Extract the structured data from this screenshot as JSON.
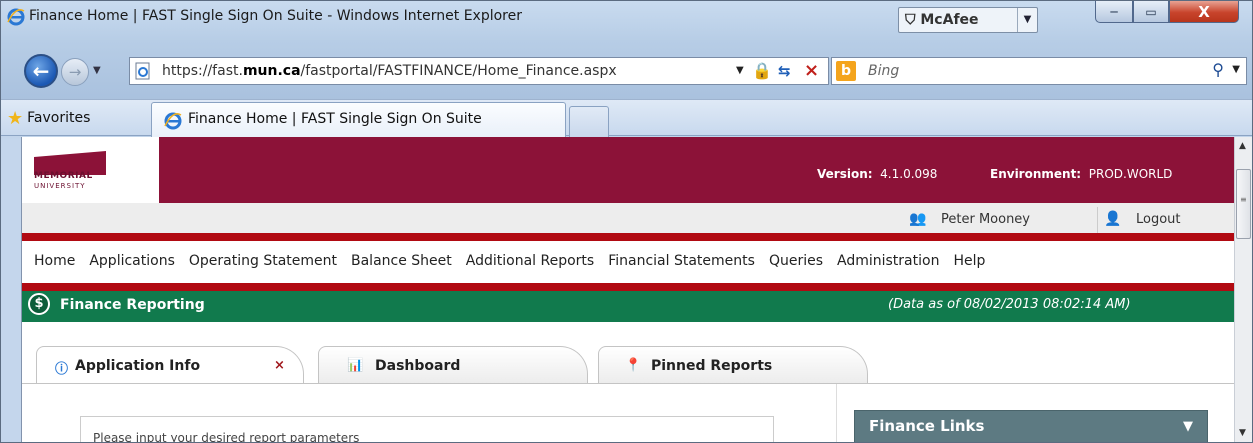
{
  "window": {
    "title": "Finance Home | FAST Single Sign On Suite - Windows Internet Explorer",
    "mcafee_label": "McAfee",
    "controls": {
      "minimize": "─",
      "maximize": "▭",
      "close": "X"
    }
  },
  "navigation": {
    "url_prefix": "https://fast.",
    "url_domain": "mun.ca",
    "url_path": "/fastportal/FASTFINANCE/Home_Finance.aspx",
    "search_placeholder": "Bing"
  },
  "favorites_bar": {
    "favorites_label": "Favorites",
    "tab_title": "Finance Home | FAST Single Sign On Suite"
  },
  "header": {
    "logo_text": "MEMORIAL",
    "logo_sub": "UNIVERSITY",
    "version_label": "Version:",
    "version_value": "4.1.0.098",
    "environment_label": "Environment:",
    "environment_value": "PROD.WORLD"
  },
  "user": {
    "name": "Peter Mooney",
    "logout_label": "Logout"
  },
  "menu": {
    "items": [
      "Home",
      "Applications",
      "Operating Statement",
      "Balance Sheet",
      "Additional Reports",
      "Financial Statements",
      "Queries",
      "Administration",
      "Help"
    ]
  },
  "finance_bar": {
    "title": "Finance Reporting",
    "data_as_of": "(Data as of 08/02/2013 08:02:14 AM)"
  },
  "app_tabs": {
    "tabs": [
      {
        "label": "Application Info",
        "icon": "info-icon",
        "closable": true
      },
      {
        "label": "Dashboard",
        "icon": "bar-chart-icon"
      },
      {
        "label": "Pinned Reports",
        "icon": "pin-icon"
      }
    ],
    "close_glyph": "×"
  },
  "main": {
    "hint_text": "Please input your desired report parameters",
    "finance_links_title": "Finance Links"
  },
  "colors": {
    "brand_maroon": "#8c1238",
    "finance_green": "#117a4d",
    "annotation_red": "#b10a12",
    "links_panel": "#5d7a82"
  }
}
